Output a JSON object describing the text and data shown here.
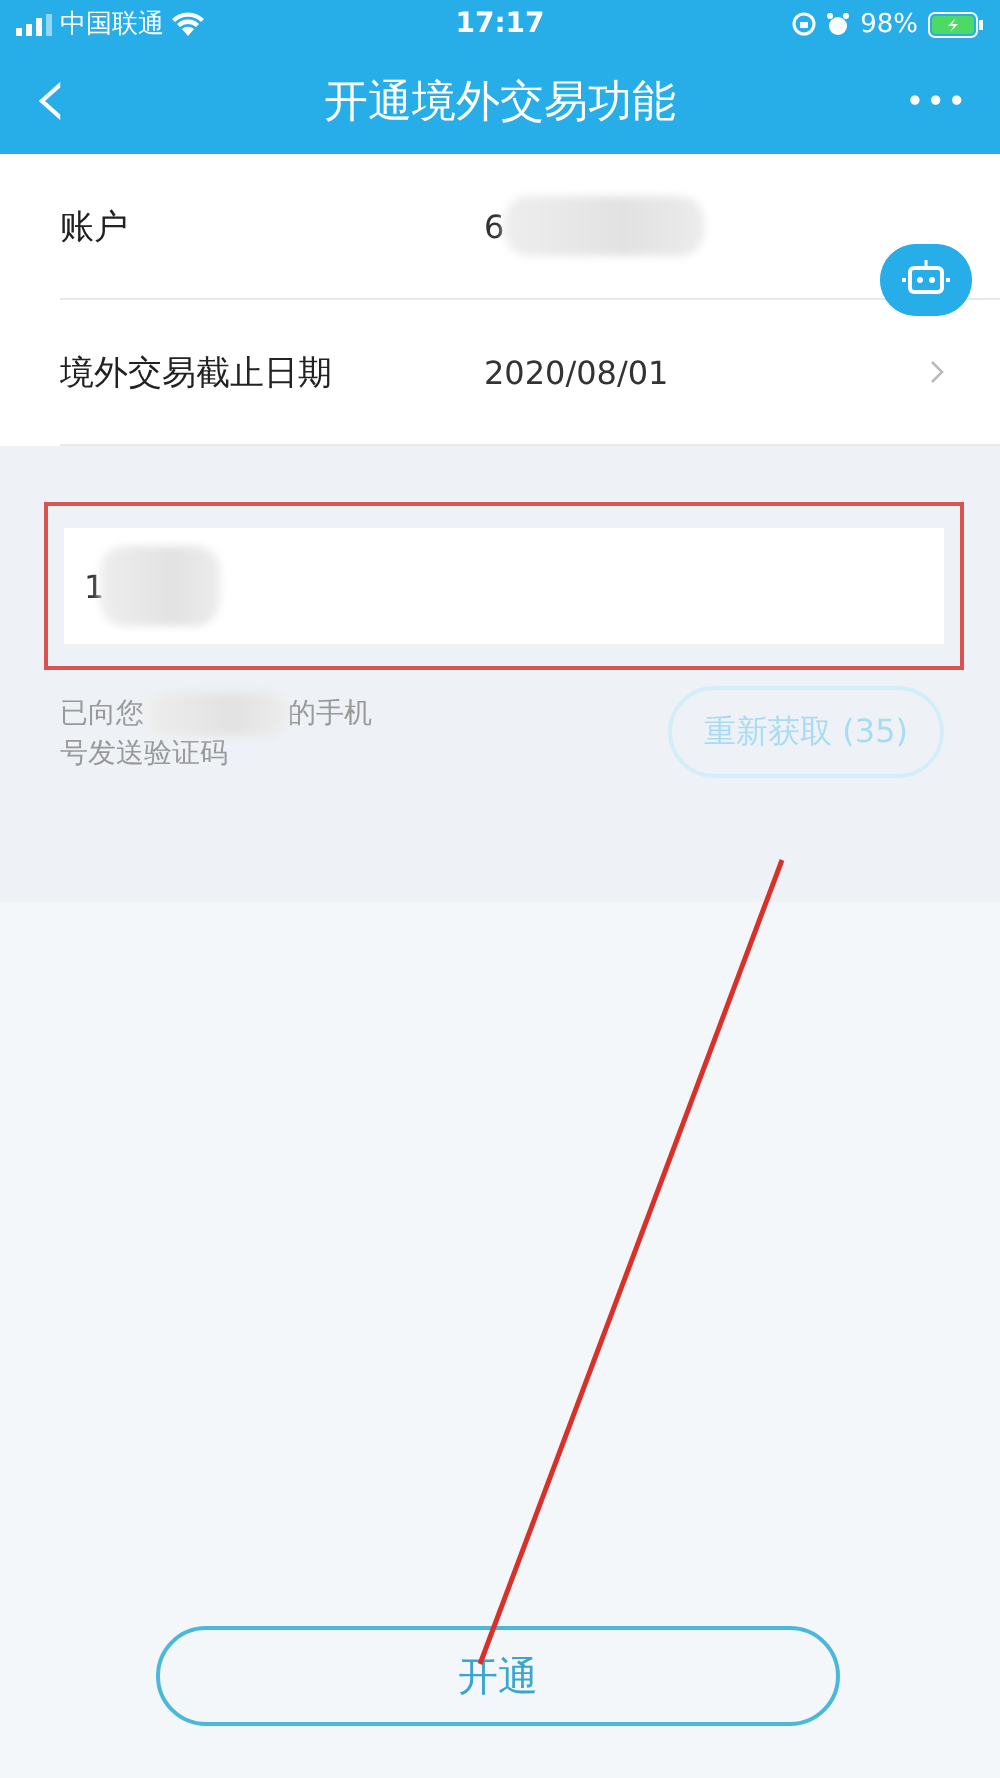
{
  "status_bar": {
    "carrier": "中国联通",
    "time": "17:17",
    "battery": "98%"
  },
  "header": {
    "back_icon": "‹",
    "title": "开通境外交易功能",
    "more": "•••"
  },
  "rows": [
    {
      "label": "账户",
      "value": "6",
      "redacted": true,
      "chevron": false
    },
    {
      "label": "境外交易截止日期",
      "value": "2020/08/01",
      "redacted": false,
      "chevron": true
    }
  ],
  "code_field": {
    "value": "1",
    "highlighted": true
  },
  "sms_notice": {
    "before": "已向您",
    "after": "的手机号发送验证码"
  },
  "resend_button": {
    "label": "重新获取 (35)",
    "disabled": true
  },
  "submit_button": {
    "label": "开通"
  }
}
